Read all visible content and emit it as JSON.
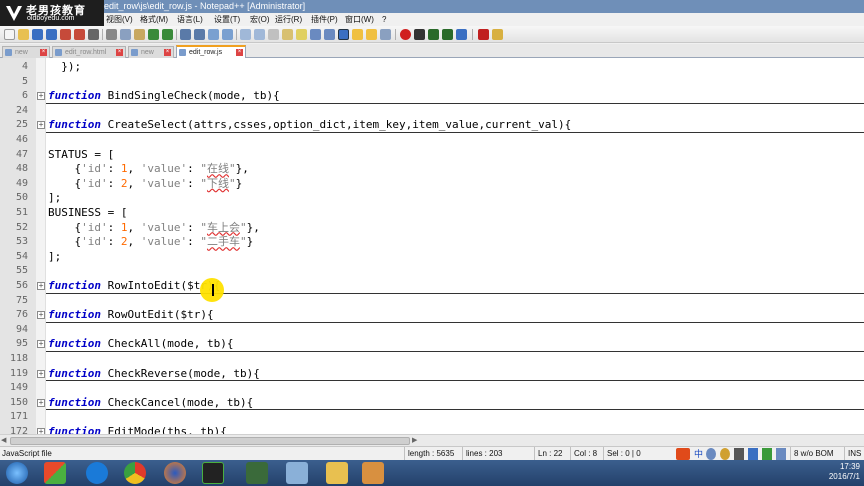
{
  "window": {
    "title": "edit_row\\js\\edit_row.js - Notepad++ [Administrator]"
  },
  "watermark": {
    "name": "老男孩教育",
    "site": "oldboyedu.com"
  },
  "menu": [
    "视图(V)",
    "格式(M)",
    "语言(L)",
    "设置(T)",
    "宏(O)",
    "运行(R)",
    "插件(P)",
    "窗口(W)",
    "?"
  ],
  "tabs": [
    {
      "label": "new",
      "active": false
    },
    {
      "label": "edit_row.html",
      "active": false
    },
    {
      "label": "new",
      "active": false
    },
    {
      "label": "edit_row.js",
      "active": true
    }
  ],
  "editor": {
    "lines": [
      {
        "n": "4",
        "code": "  });",
        "fold": ""
      },
      {
        "n": "5",
        "code": "",
        "fold": ""
      },
      {
        "n": "6",
        "fn": "BindSingleCheck(mode, tb){",
        "fold": "+"
      },
      {
        "n": "24",
        "code": "",
        "fold": ""
      },
      {
        "n": "25",
        "fn": "CreateSelect(attrs,csses,option_dict,item_key,item_value,current_val){",
        "fold": "+"
      },
      {
        "n": "46",
        "code": "",
        "fold": ""
      },
      {
        "n": "47",
        "code": "STATUS = [",
        "fold": ""
      },
      {
        "n": "48",
        "item": {
          "id": "1",
          "value": "在线"
        },
        "fold": ""
      },
      {
        "n": "49",
        "item": {
          "id": "2",
          "value": "下线"
        },
        "fold": ""
      },
      {
        "n": "50",
        "code": "];",
        "fold": ""
      },
      {
        "n": "51",
        "code": "BUSINESS = [",
        "fold": ""
      },
      {
        "n": "52",
        "item": {
          "id": "1",
          "value": "车上会"
        },
        "fold": ""
      },
      {
        "n": "53",
        "item": {
          "id": "2",
          "value": "二手车"
        },
        "fold": ""
      },
      {
        "n": "54",
        "code": "];",
        "fold": ""
      },
      {
        "n": "55",
        "code": "",
        "fold": ""
      },
      {
        "n": "56",
        "fn": "RowIntoEdit($tr){",
        "fold": "+"
      },
      {
        "n": "75",
        "code": "",
        "fold": ""
      },
      {
        "n": "76",
        "fn": "RowOutEdit($tr){",
        "fold": "+"
      },
      {
        "n": "94",
        "code": "",
        "fold": ""
      },
      {
        "n": "95",
        "fn": "CheckAll(mode, tb){",
        "fold": "+"
      },
      {
        "n": "118",
        "code": "",
        "fold": ""
      },
      {
        "n": "119",
        "fn": "CheckReverse(mode, tb){",
        "fold": "+"
      },
      {
        "n": "149",
        "code": "",
        "fold": ""
      },
      {
        "n": "150",
        "fn": "CheckCancel(mode, tb){",
        "fold": "+"
      },
      {
        "n": "171",
        "code": "",
        "fold": ""
      },
      {
        "n": "172",
        "fn": "EditMode(ths, tb){",
        "fold": "+"
      }
    ],
    "keyword": "function"
  },
  "status": {
    "filetype": "JavaScript file",
    "length": "length : 5635",
    "lines": "lines : 203",
    "ln": "Ln : 22",
    "col": "Col : 8",
    "sel": "Sel : 0 | 0",
    "encoding": "8 w/o BOM",
    "ins": "INS"
  },
  "taskbar": {
    "time": "17:39",
    "date": "2016/7/1"
  }
}
